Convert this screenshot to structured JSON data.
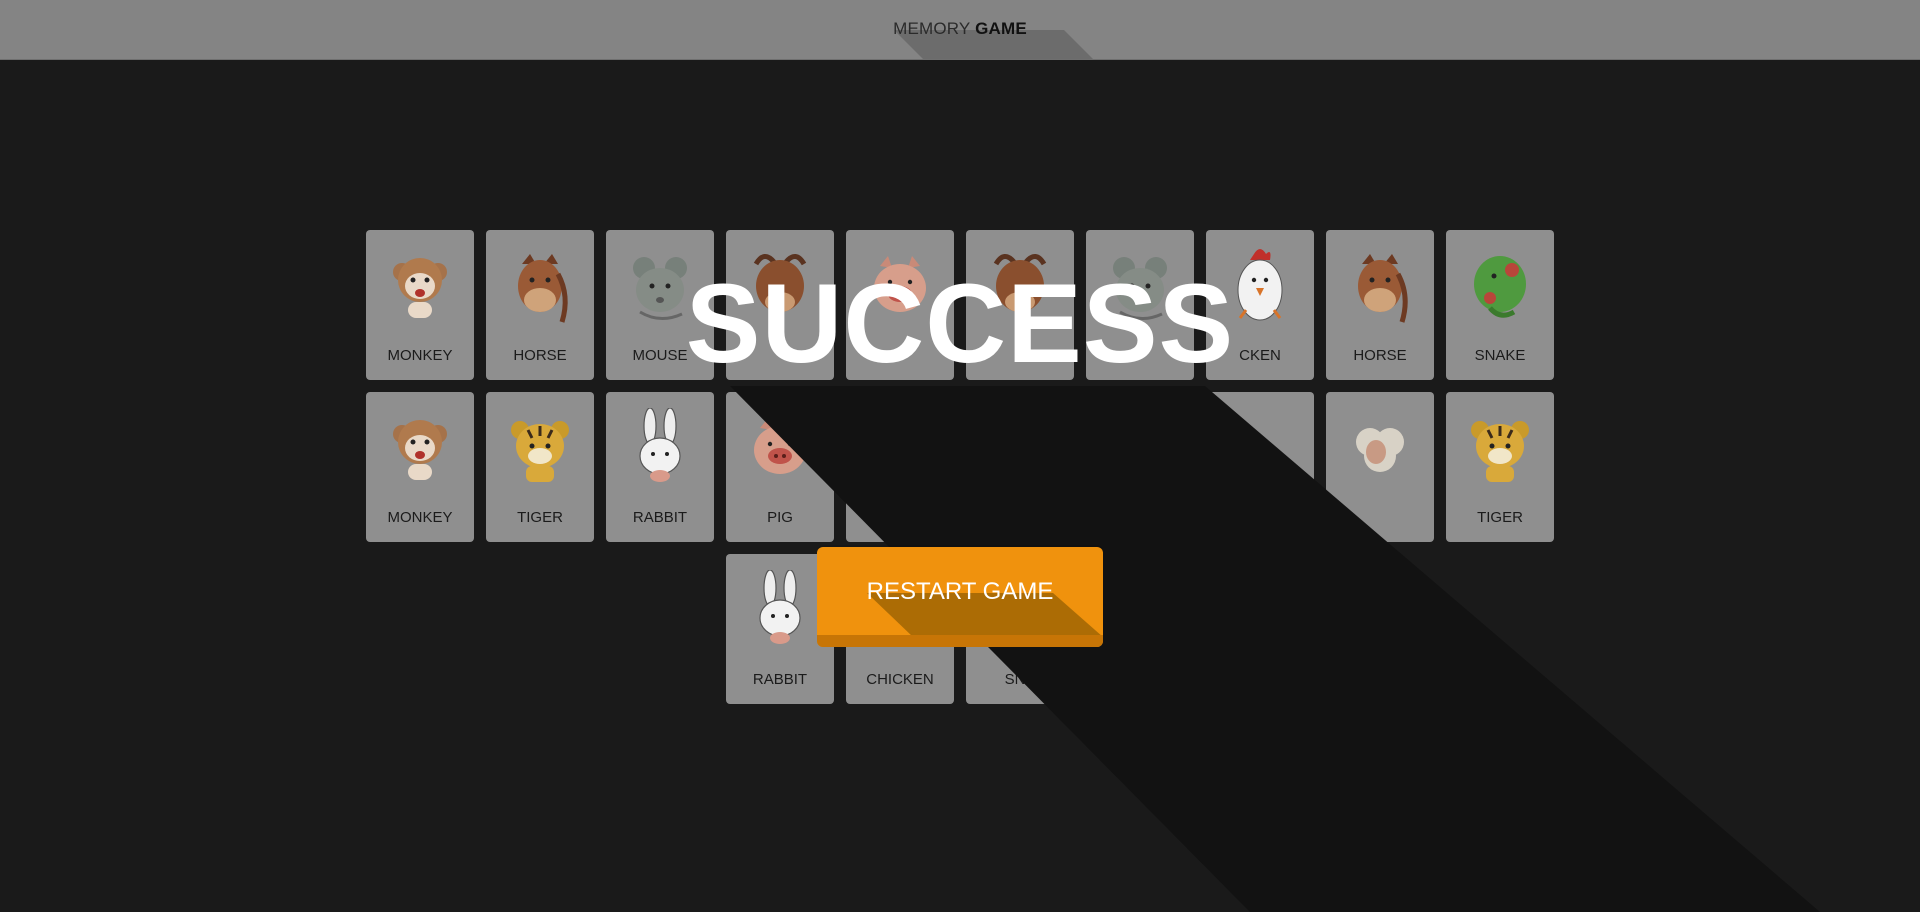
{
  "header": {
    "title_light": "MEMORY",
    "title_bold": "GAME"
  },
  "success_text": "SUCCESS",
  "restart_label": "RESTART GAME",
  "colors": {
    "accent": "#f0920d",
    "card_bg": "#8f8f8f",
    "background": "#1a1a1a",
    "header_bg": "#848484"
  },
  "cards": [
    {
      "label": "MONKEY",
      "icon": "monkey-icon"
    },
    {
      "label": "HORSE",
      "icon": "horse-icon"
    },
    {
      "label": "MOUSE",
      "icon": "mouse-icon"
    },
    {
      "label": "",
      "icon": "ox-icon"
    },
    {
      "label": "",
      "icon": "pig-icon"
    },
    {
      "label": "",
      "icon": "ox-icon"
    },
    {
      "label": "",
      "icon": "mouse-icon"
    },
    {
      "label": "CKEN",
      "icon": "chicken-icon"
    },
    {
      "label": "HORSE",
      "icon": "horse-icon"
    },
    {
      "label": "SNAKE",
      "icon": "snake-icon"
    },
    {
      "label": "MONKEY",
      "icon": "monkey-icon"
    },
    {
      "label": "TIGER",
      "icon": "tiger-icon"
    },
    {
      "label": "RABBIT",
      "icon": "rabbit-icon"
    },
    {
      "label": "PIG",
      "icon": "pig-icon"
    },
    {
      "label": "",
      "icon": ""
    },
    {
      "label": "",
      "icon": ""
    },
    {
      "label": "",
      "icon": ""
    },
    {
      "label": "",
      "icon": ""
    },
    {
      "label": "",
      "icon": "sheep-icon"
    },
    {
      "label": "TIGER",
      "icon": "tiger-icon"
    },
    {
      "label": "RABBIT",
      "icon": "rabbit-icon"
    },
    {
      "label": "CHICKEN",
      "icon": "chicken-icon"
    },
    {
      "label": "SNA",
      "icon": "snake-icon"
    }
  ]
}
